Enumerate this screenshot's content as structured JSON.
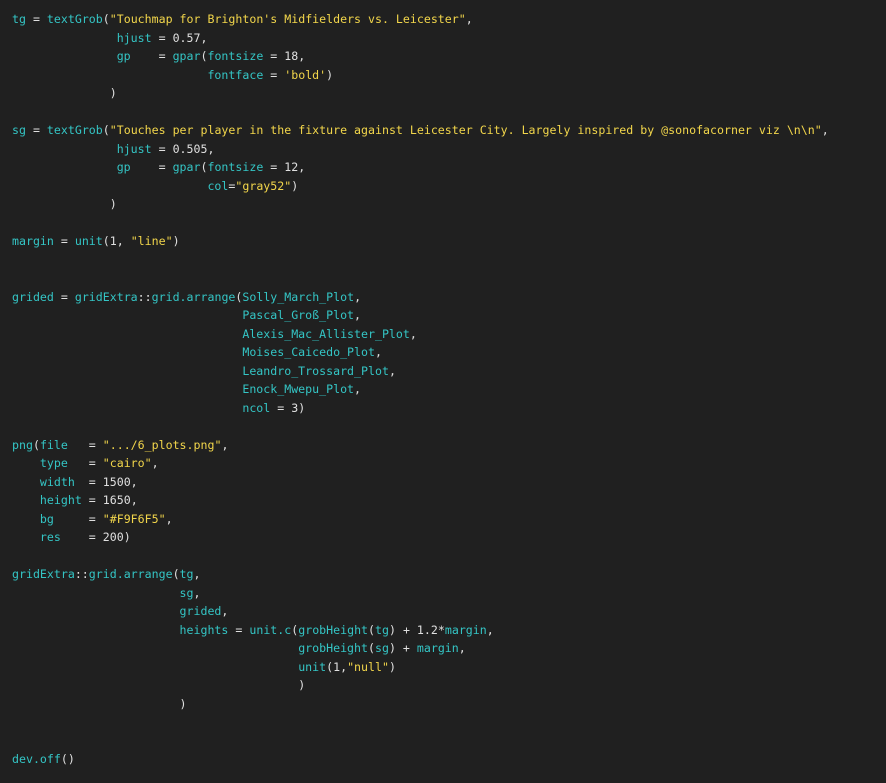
{
  "editor": {
    "lines": [
      [
        {
          "t": "tg",
          "k": "var"
        },
        {
          "t": " = ",
          "k": "op"
        },
        {
          "t": "textGrob",
          "k": "fn"
        },
        {
          "t": "(",
          "k": "punct"
        },
        {
          "t": "\"Touchmap for Brighton's Midfielders vs. Leicester\"",
          "k": "str"
        },
        {
          "t": ",",
          "k": "punct"
        }
      ],
      [
        {
          "t": "               ",
          "k": "op"
        },
        {
          "t": "hjust",
          "k": "var"
        },
        {
          "t": " = ",
          "k": "op"
        },
        {
          "t": "0.57",
          "k": "num"
        },
        {
          "t": ",",
          "k": "punct"
        }
      ],
      [
        {
          "t": "               ",
          "k": "op"
        },
        {
          "t": "gp",
          "k": "var"
        },
        {
          "t": "    = ",
          "k": "op"
        },
        {
          "t": "gpar",
          "k": "fn"
        },
        {
          "t": "(",
          "k": "punct"
        },
        {
          "t": "fontsize",
          "k": "var"
        },
        {
          "t": " = ",
          "k": "op"
        },
        {
          "t": "18",
          "k": "num"
        },
        {
          "t": ",",
          "k": "punct"
        }
      ],
      [
        {
          "t": "                            ",
          "k": "op"
        },
        {
          "t": "fontface",
          "k": "var"
        },
        {
          "t": " = ",
          "k": "op"
        },
        {
          "t": "'bold'",
          "k": "str"
        },
        {
          "t": ")",
          "k": "punct"
        }
      ],
      [
        {
          "t": "              ",
          "k": "op"
        },
        {
          "t": ")",
          "k": "punct"
        }
      ],
      [],
      [
        {
          "t": "sg",
          "k": "var"
        },
        {
          "t": " = ",
          "k": "op"
        },
        {
          "t": "textGrob",
          "k": "fn"
        },
        {
          "t": "(",
          "k": "punct"
        },
        {
          "t": "\"Touches per player in the fixture against Leicester City. Largely inspired by @sonofacorner viz \\n\\n\"",
          "k": "str"
        },
        {
          "t": ",",
          "k": "punct"
        }
      ],
      [
        {
          "t": "               ",
          "k": "op"
        },
        {
          "t": "hjust",
          "k": "var"
        },
        {
          "t": " = ",
          "k": "op"
        },
        {
          "t": "0.505",
          "k": "num"
        },
        {
          "t": ",",
          "k": "punct"
        }
      ],
      [
        {
          "t": "               ",
          "k": "op"
        },
        {
          "t": "gp",
          "k": "var"
        },
        {
          "t": "    = ",
          "k": "op"
        },
        {
          "t": "gpar",
          "k": "fn"
        },
        {
          "t": "(",
          "k": "punct"
        },
        {
          "t": "fontsize",
          "k": "var"
        },
        {
          "t": " = ",
          "k": "op"
        },
        {
          "t": "12",
          "k": "num"
        },
        {
          "t": ",",
          "k": "punct"
        }
      ],
      [
        {
          "t": "                            ",
          "k": "op"
        },
        {
          "t": "col",
          "k": "var"
        },
        {
          "t": "=",
          "k": "op"
        },
        {
          "t": "\"gray52\"",
          "k": "str"
        },
        {
          "t": ")",
          "k": "punct"
        }
      ],
      [
        {
          "t": "              ",
          "k": "op"
        },
        {
          "t": ")",
          "k": "punct"
        }
      ],
      [],
      [
        {
          "t": "margin",
          "k": "var"
        },
        {
          "t": " = ",
          "k": "op"
        },
        {
          "t": "unit",
          "k": "fn"
        },
        {
          "t": "(",
          "k": "punct"
        },
        {
          "t": "1",
          "k": "num"
        },
        {
          "t": ", ",
          "k": "punct"
        },
        {
          "t": "\"line\"",
          "k": "str"
        },
        {
          "t": ")",
          "k": "punct"
        }
      ],
      [],
      [],
      [
        {
          "t": "grided",
          "k": "var"
        },
        {
          "t": " = ",
          "k": "op"
        },
        {
          "t": "gridExtra",
          "k": "fn"
        },
        {
          "t": "::",
          "k": "op"
        },
        {
          "t": "grid.arrange",
          "k": "fn"
        },
        {
          "t": "(",
          "k": "punct"
        },
        {
          "t": "Solly_March_Plot",
          "k": "var"
        },
        {
          "t": ",",
          "k": "punct"
        }
      ],
      [
        {
          "t": "                                 ",
          "k": "op"
        },
        {
          "t": "Pascal_Groß_Plot",
          "k": "var"
        },
        {
          "t": ",",
          "k": "punct"
        }
      ],
      [
        {
          "t": "                                 ",
          "k": "op"
        },
        {
          "t": "Alexis_Mac_Allister_Plot",
          "k": "var"
        },
        {
          "t": ",",
          "k": "punct"
        }
      ],
      [
        {
          "t": "                                 ",
          "k": "op"
        },
        {
          "t": "Moises_Caicedo_Plot",
          "k": "var"
        },
        {
          "t": ",",
          "k": "punct"
        }
      ],
      [
        {
          "t": "                                 ",
          "k": "op"
        },
        {
          "t": "Leandro_Trossard_Plot",
          "k": "var"
        },
        {
          "t": ",",
          "k": "punct"
        }
      ],
      [
        {
          "t": "                                 ",
          "k": "op"
        },
        {
          "t": "Enock_Mwepu_Plot",
          "k": "var"
        },
        {
          "t": ",",
          "k": "punct"
        }
      ],
      [
        {
          "t": "                                 ",
          "k": "op"
        },
        {
          "t": "ncol",
          "k": "var"
        },
        {
          "t": " = ",
          "k": "op"
        },
        {
          "t": "3",
          "k": "num"
        },
        {
          "t": ")",
          "k": "punct"
        }
      ],
      [],
      [
        {
          "t": "png",
          "k": "fn"
        },
        {
          "t": "(",
          "k": "punct"
        },
        {
          "t": "file",
          "k": "var"
        },
        {
          "t": "   = ",
          "k": "op"
        },
        {
          "t": "\".../6_plots.png\"",
          "k": "str"
        },
        {
          "t": ",",
          "k": "punct"
        }
      ],
      [
        {
          "t": "    ",
          "k": "op"
        },
        {
          "t": "type",
          "k": "var"
        },
        {
          "t": "   = ",
          "k": "op"
        },
        {
          "t": "\"cairo\"",
          "k": "str"
        },
        {
          "t": ",",
          "k": "punct"
        }
      ],
      [
        {
          "t": "    ",
          "k": "op"
        },
        {
          "t": "width",
          "k": "var"
        },
        {
          "t": "  = ",
          "k": "op"
        },
        {
          "t": "1500",
          "k": "num"
        },
        {
          "t": ",",
          "k": "punct"
        }
      ],
      [
        {
          "t": "    ",
          "k": "op"
        },
        {
          "t": "height",
          "k": "var"
        },
        {
          "t": " = ",
          "k": "op"
        },
        {
          "t": "1650",
          "k": "num"
        },
        {
          "t": ",",
          "k": "punct"
        }
      ],
      [
        {
          "t": "    ",
          "k": "op"
        },
        {
          "t": "bg",
          "k": "var"
        },
        {
          "t": "     = ",
          "k": "op"
        },
        {
          "t": "\"#F9F6F5\"",
          "k": "str"
        },
        {
          "t": ",",
          "k": "punct"
        }
      ],
      [
        {
          "t": "    ",
          "k": "op"
        },
        {
          "t": "res",
          "k": "var"
        },
        {
          "t": "    = ",
          "k": "op"
        },
        {
          "t": "200",
          "k": "num"
        },
        {
          "t": ")",
          "k": "punct"
        }
      ],
      [],
      [
        {
          "t": "gridExtra",
          "k": "fn"
        },
        {
          "t": "::",
          "k": "op"
        },
        {
          "t": "grid.arrange",
          "k": "fn"
        },
        {
          "t": "(",
          "k": "punct"
        },
        {
          "t": "tg",
          "k": "var"
        },
        {
          "t": ",",
          "k": "punct"
        }
      ],
      [
        {
          "t": "                        ",
          "k": "op"
        },
        {
          "t": "sg",
          "k": "var"
        },
        {
          "t": ",",
          "k": "punct"
        }
      ],
      [
        {
          "t": "                        ",
          "k": "op"
        },
        {
          "t": "grided",
          "k": "var"
        },
        {
          "t": ",",
          "k": "punct"
        }
      ],
      [
        {
          "t": "                        ",
          "k": "op"
        },
        {
          "t": "heights",
          "k": "var"
        },
        {
          "t": " = ",
          "k": "op"
        },
        {
          "t": "unit.c",
          "k": "fn"
        },
        {
          "t": "(",
          "k": "punct"
        },
        {
          "t": "grobHeight",
          "k": "fn"
        },
        {
          "t": "(",
          "k": "punct"
        },
        {
          "t": "tg",
          "k": "var"
        },
        {
          "t": ") + ",
          "k": "op"
        },
        {
          "t": "1.2",
          "k": "num"
        },
        {
          "t": "*",
          "k": "op"
        },
        {
          "t": "margin",
          "k": "var"
        },
        {
          "t": ",",
          "k": "punct"
        }
      ],
      [
        {
          "t": "                                         ",
          "k": "op"
        },
        {
          "t": "grobHeight",
          "k": "fn"
        },
        {
          "t": "(",
          "k": "punct"
        },
        {
          "t": "sg",
          "k": "var"
        },
        {
          "t": ") + ",
          "k": "op"
        },
        {
          "t": "margin",
          "k": "var"
        },
        {
          "t": ",",
          "k": "punct"
        }
      ],
      [
        {
          "t": "                                         ",
          "k": "op"
        },
        {
          "t": "unit",
          "k": "fn"
        },
        {
          "t": "(",
          "k": "punct"
        },
        {
          "t": "1",
          "k": "num"
        },
        {
          "t": ",",
          "k": "punct"
        },
        {
          "t": "\"null\"",
          "k": "str"
        },
        {
          "t": ")",
          "k": "punct"
        }
      ],
      [
        {
          "t": "                                         ",
          "k": "op"
        },
        {
          "t": ")",
          "k": "punct"
        }
      ],
      [
        {
          "t": "                        ",
          "k": "op"
        },
        {
          "t": ")",
          "k": "punct"
        }
      ],
      [],
      [],
      [
        {
          "t": "dev.off",
          "k": "fn"
        },
        {
          "t": "()",
          "k": "punct"
        }
      ]
    ]
  }
}
